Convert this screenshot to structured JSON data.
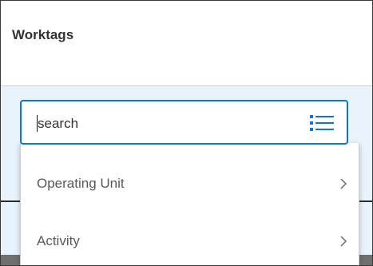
{
  "panel": {
    "title": "Worktags"
  },
  "search": {
    "value": "search",
    "icon": "list-icon"
  },
  "dropdown": {
    "items": [
      {
        "label": "Operating Unit",
        "icon": "chevron-right-icon"
      },
      {
        "label": "Activity",
        "icon": "chevron-right-icon"
      }
    ]
  },
  "colors": {
    "accent": "#0875e1",
    "backdrop": "#e9f3fb",
    "text": "#333333",
    "muted_text": "#595959"
  }
}
